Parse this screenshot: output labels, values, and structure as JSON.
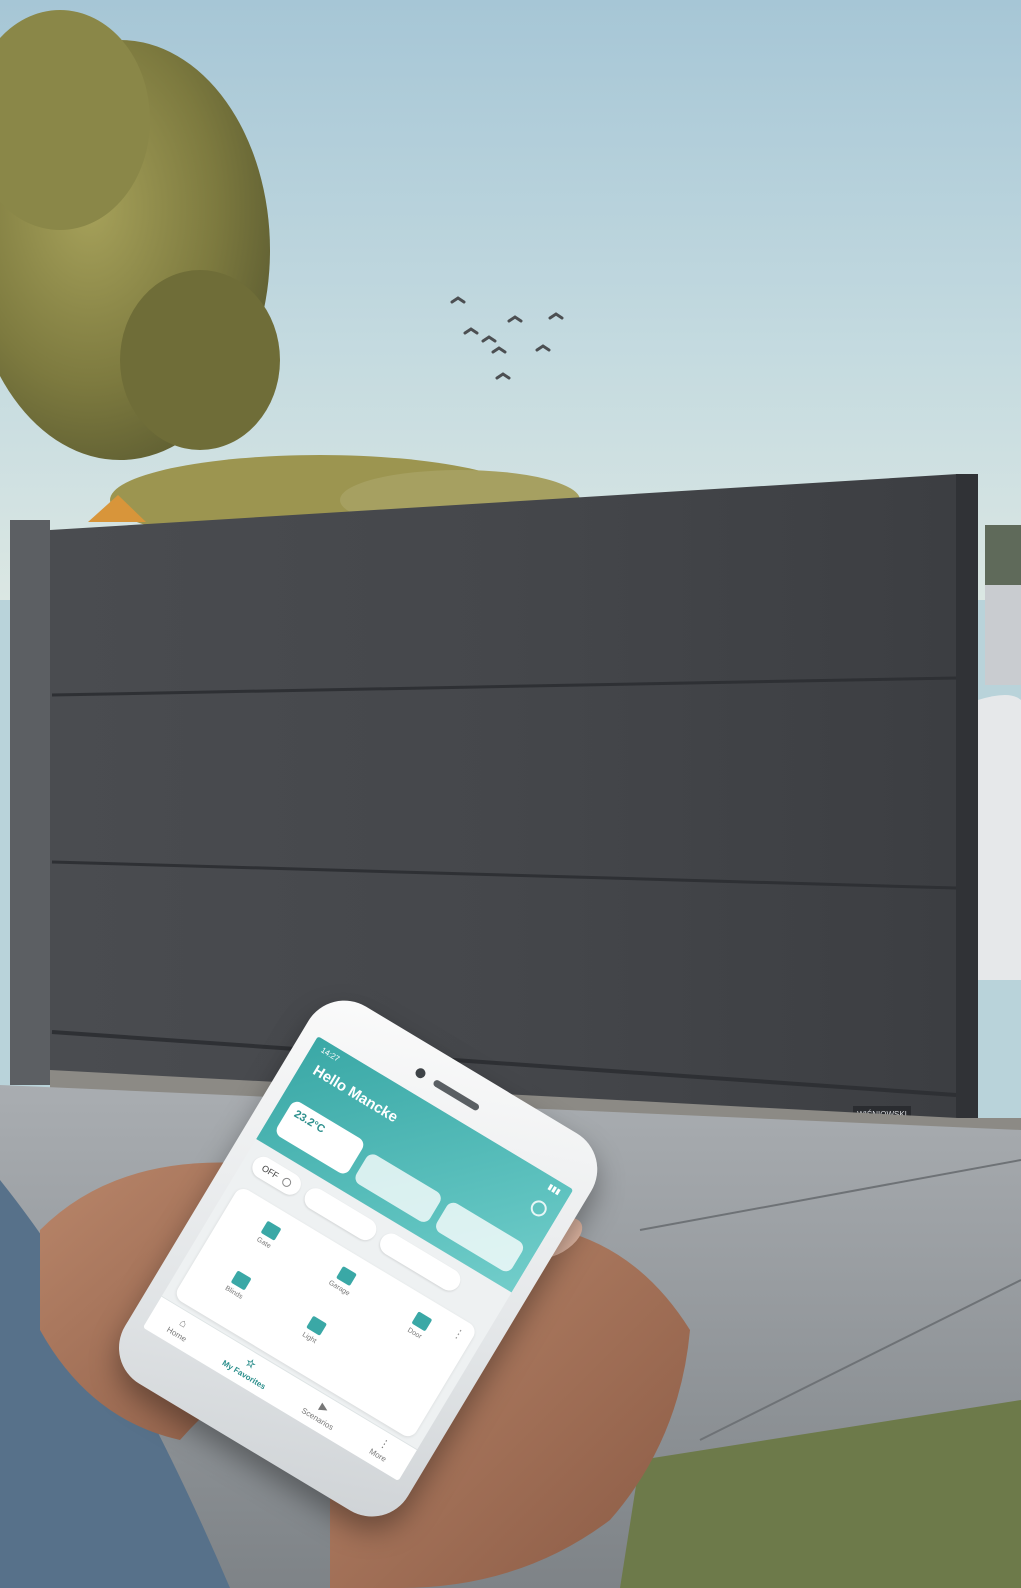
{
  "scene": {
    "description_objects": [
      "sky",
      "tree",
      "birds",
      "sliding-gate",
      "driveway",
      "grass",
      "hands",
      "smartphone"
    ],
    "brand_plate": "WIŚNIOWSKI"
  },
  "app": {
    "status_time": "14:27",
    "greeting": "Hello Mancke",
    "weather_temp": "23.2°C",
    "pills": [
      "OFF"
    ],
    "devices": [
      {
        "label": "Gate"
      },
      {
        "label": "Garage"
      },
      {
        "label": "Door"
      },
      {
        "label": "Blinds"
      },
      {
        "label": "Light"
      }
    ],
    "tabs": [
      {
        "label": "Home",
        "glyph": "⌂"
      },
      {
        "label": "My Favorites",
        "glyph": "☆"
      },
      {
        "label": "Scenarios",
        "glyph": "▶"
      },
      {
        "label": "More",
        "glyph": "⋮"
      }
    ]
  },
  "colors": {
    "accent": "#3aa8a6",
    "gate": "#45474b",
    "sky_top": "#a9c8d6",
    "sky_bottom": "#d9e6e4"
  }
}
